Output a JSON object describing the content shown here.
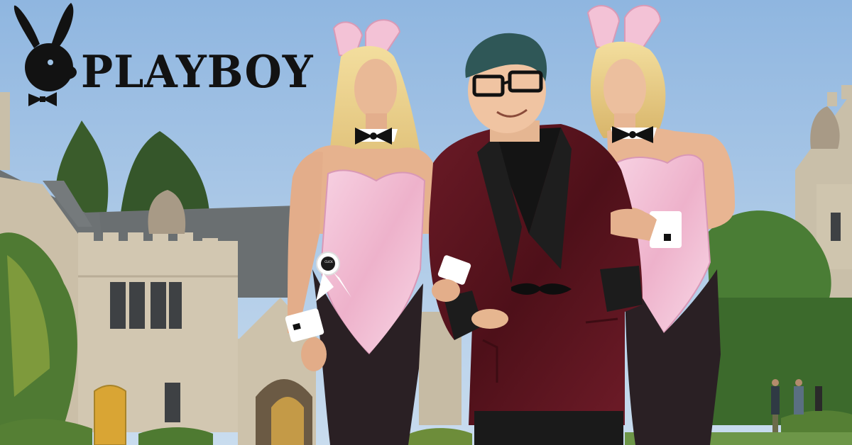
{
  "brand": {
    "wordmark": "PLAYBOY",
    "logo_icon": "rabbit-head-bowtie-icon"
  },
  "badge": {
    "text": "CLICK"
  },
  "colors": {
    "sky": "#9fc3e6",
    "stone": "#cbbfa8",
    "roof": "#6f7273",
    "foliage": "#3f6b2e",
    "bunny_pink": "#f2bcd2",
    "jacket": "#5a1520",
    "wordmark": "#121212"
  }
}
